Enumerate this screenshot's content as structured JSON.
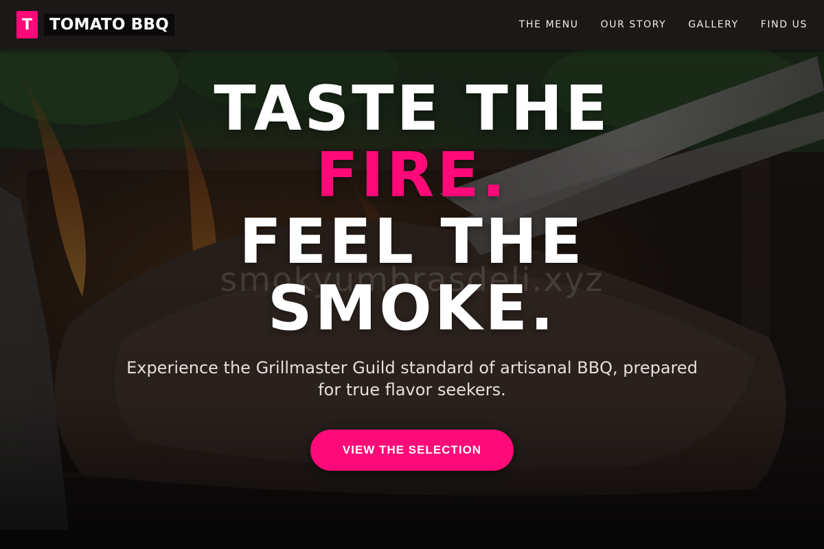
{
  "header": {
    "logo_letter": "T",
    "brand_name": "TOMATO BBQ",
    "nav": [
      {
        "label": "THE MENU"
      },
      {
        "label": "OUR STORY"
      },
      {
        "label": "GALLERY"
      },
      {
        "label": "FIND US"
      }
    ]
  },
  "hero": {
    "headline_line1": "TASTE THE",
    "headline_accent": "FIRE.",
    "headline_line3": "FEEL THE",
    "headline_line4": "SMOKE.",
    "watermark": "smokyumbrasdeli.xyz",
    "subtitle": "Experience the Grillmaster Guild standard of artisanal BBQ, prepared for true flavor seekers.",
    "cta_label": "VIEW THE SELECTION"
  },
  "theme": {
    "accent": "#ff0a78",
    "navbar_bg": "#1b1817",
    "text": "#ffffff"
  }
}
